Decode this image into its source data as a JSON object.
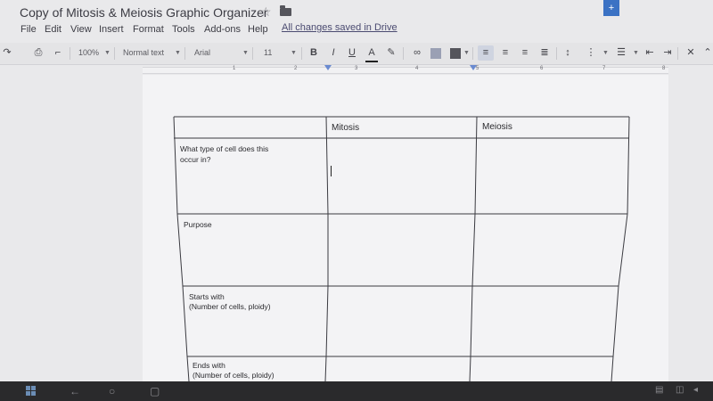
{
  "window": {
    "doc_title": "Copy of Mitosis & Meiosis Graphic Organizer",
    "account_icon_label": "+"
  },
  "menu": {
    "items": [
      "File",
      "Edit",
      "View",
      "Insert",
      "Format",
      "Tools",
      "Add-ons",
      "Help"
    ],
    "save_status": "All changes saved in Drive"
  },
  "toolbar": {
    "zoom": "100%",
    "style": "Normal text",
    "font": "Arial",
    "font_size": "11",
    "bold": "B",
    "italic": "I",
    "underline": "U",
    "text_color": "A"
  },
  "ruler": {
    "numbers": [
      "1",
      "2",
      "3",
      "4",
      "5",
      "6",
      "7",
      "8"
    ]
  },
  "table": {
    "headers": [
      "",
      "Mitosis",
      "Meiosis"
    ],
    "rows": [
      {
        "label": [
          "What type of cell does this",
          "occur in?"
        ]
      },
      {
        "label": [
          "Purpose"
        ]
      },
      {
        "label": [
          "Starts with",
          "(Number of cells, ploidy)"
        ]
      },
      {
        "label": [
          "Ends with",
          "(Number of cells, ploidy)"
        ]
      }
    ]
  },
  "colors": {
    "accent": "#3b72c4",
    "page": "#f3f3f5",
    "taskbar": "#2a2a2c"
  }
}
